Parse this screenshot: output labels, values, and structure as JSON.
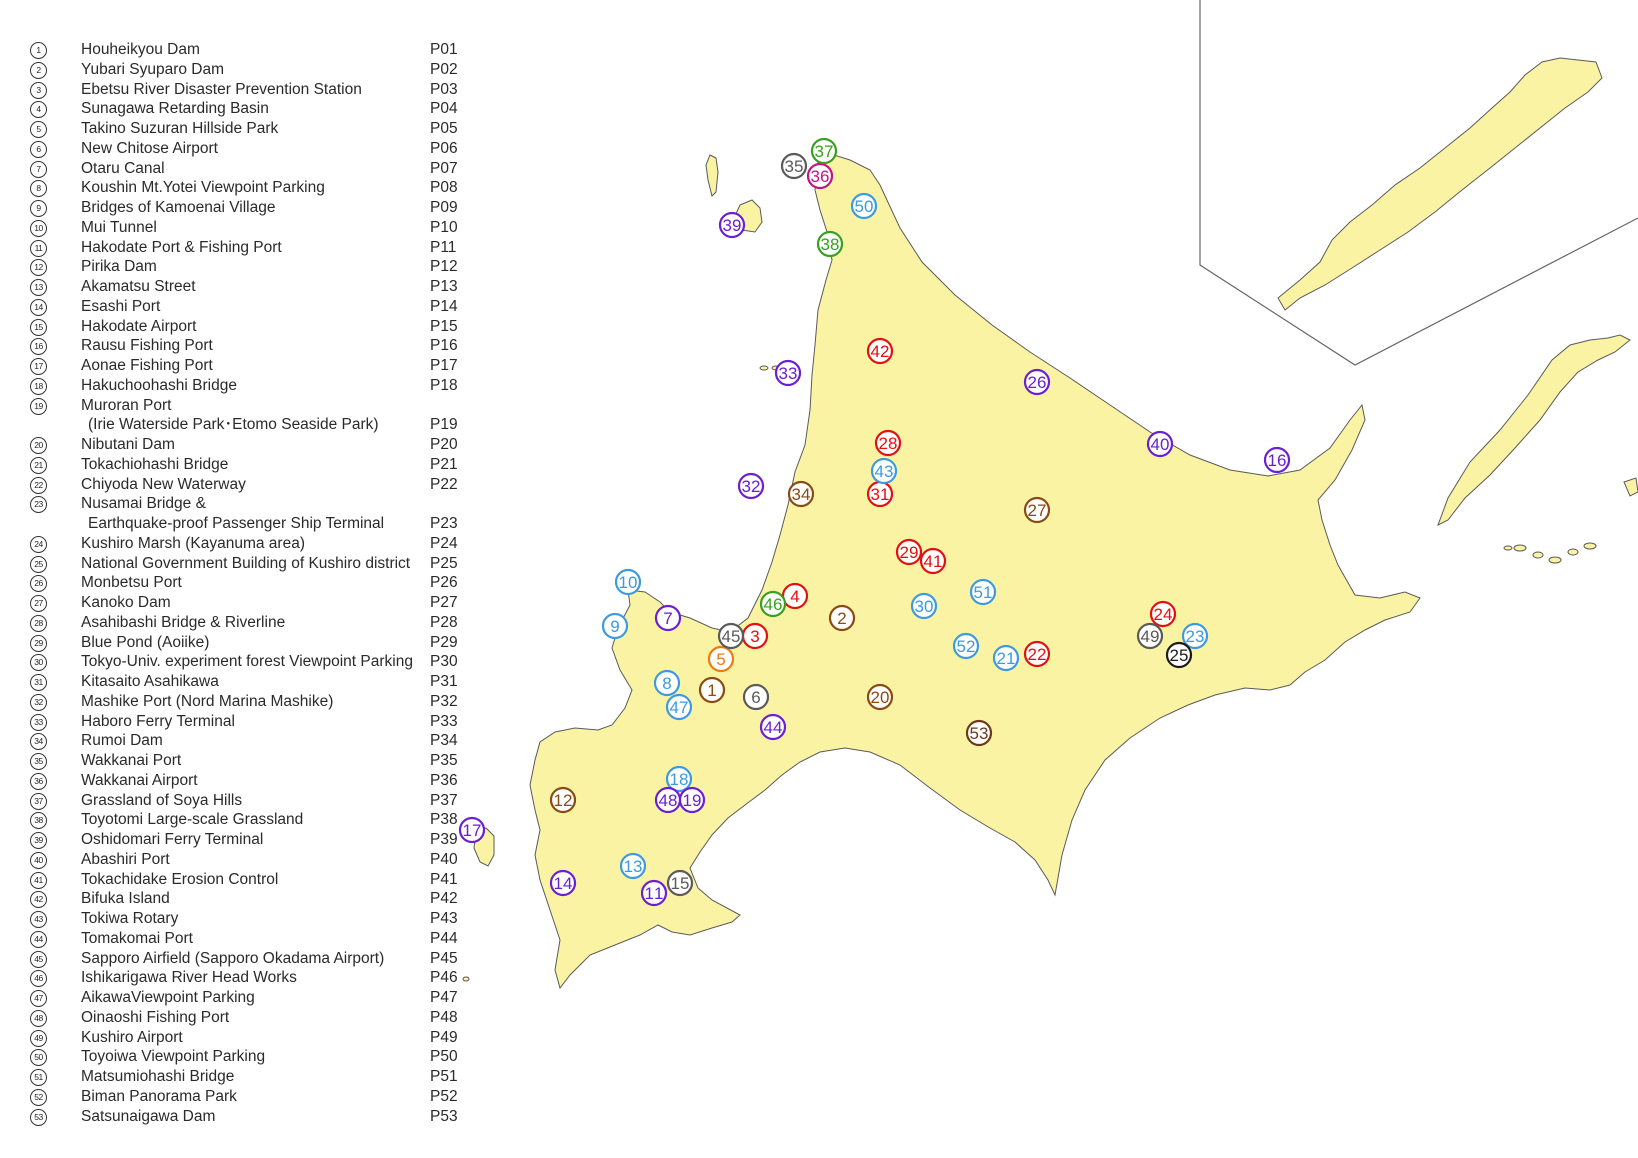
{
  "legend": [
    {
      "num": "1",
      "name": "Houheikyou Dam",
      "code": "P01"
    },
    {
      "num": "2",
      "name": "Yubari Syuparo Dam",
      "code": "P02"
    },
    {
      "num": "3",
      "name": "Ebetsu River Disaster Prevention Station",
      "code": "P03"
    },
    {
      "num": "4",
      "name": "Sunagawa Retarding Basin",
      "code": "P04"
    },
    {
      "num": "5",
      "name": "Takino Suzuran Hillside Park",
      "code": "P05"
    },
    {
      "num": "6",
      "name": "New Chitose Airport",
      "code": "P06"
    },
    {
      "num": "7",
      "name": "Otaru Canal",
      "code": "P07"
    },
    {
      "num": "8",
      "name": "Koushin Mt.Yotei Viewpoint Parking",
      "code": "P08"
    },
    {
      "num": "9",
      "name": "Bridges of Kamoenai Village",
      "code": "P09"
    },
    {
      "num": "10",
      "name": "Mui Tunnel",
      "code": "P10"
    },
    {
      "num": "11",
      "name": "Hakodate Port & Fishing Port",
      "code": "P11"
    },
    {
      "num": "12",
      "name": "Pirika Dam",
      "code": "P12"
    },
    {
      "num": "13",
      "name": "Akamatsu Street",
      "code": "P13"
    },
    {
      "num": "14",
      "name": "Esashi Port",
      "code": "P14"
    },
    {
      "num": "15",
      "name": "Hakodate Airport",
      "code": "P15"
    },
    {
      "num": "16",
      "name": "Rausu Fishing Port",
      "code": "P16"
    },
    {
      "num": "17",
      "name": "Aonae Fishing Port",
      "code": "P17"
    },
    {
      "num": "18",
      "name": "Hakuchoohashi Bridge",
      "code": "P18"
    },
    {
      "num": "19",
      "name": "Muroran Port",
      "code": ""
    },
    {
      "num": "",
      "name": "(Irie Waterside Park･Etomo Seaside Park)",
      "code": "P19"
    },
    {
      "num": "20",
      "name": "Nibutani Dam",
      "code": "P20"
    },
    {
      "num": "21",
      "name": "Tokachiohashi Bridge",
      "code": "P21"
    },
    {
      "num": "22",
      "name": "Chiyoda New Waterway",
      "code": "P22"
    },
    {
      "num": "23",
      "name": "Nusamai Bridge &",
      "code": ""
    },
    {
      "num": "",
      "name": "Earthquake-proof Passenger Ship Terminal",
      "code": "P23"
    },
    {
      "num": "24",
      "name": "Kushiro Marsh (Kayanuma area)",
      "code": "P24"
    },
    {
      "num": "25",
      "name": "National Government Building of Kushiro district",
      "code": "P25"
    },
    {
      "num": "26",
      "name": "Monbetsu Port",
      "code": "P26"
    },
    {
      "num": "27",
      "name": "Kanoko Dam",
      "code": "P27"
    },
    {
      "num": "28",
      "name": "Asahibashi Bridge & Riverline",
      "code": "P28"
    },
    {
      "num": "29",
      "name": "Blue Pond (Aoiike)",
      "code": "P29"
    },
    {
      "num": "30",
      "name": "Tokyo-Univ. experiment forest Viewpoint Parking",
      "code": "P30"
    },
    {
      "num": "31",
      "name": "Kitasaito Asahikawa",
      "code": "P31"
    },
    {
      "num": "32",
      "name": "Mashike Port (Nord Marina Mashike)",
      "code": "P32"
    },
    {
      "num": "33",
      "name": "Haboro Ferry Terminal",
      "code": "P33"
    },
    {
      "num": "34",
      "name": "Rumoi Dam",
      "code": "P34"
    },
    {
      "num": "35",
      "name": "Wakkanai Port",
      "code": "P35"
    },
    {
      "num": "36",
      "name": "Wakkanai Airport",
      "code": "P36"
    },
    {
      "num": "37",
      "name": "Grassland of Soya Hills",
      "code": "P37"
    },
    {
      "num": "38",
      "name": "Toyotomi Large-scale Grassland",
      "code": "P38"
    },
    {
      "num": "39",
      "name": "Oshidomari Ferry Terminal",
      "code": "P39"
    },
    {
      "num": "40",
      "name": "Abashiri Port",
      "code": "P40"
    },
    {
      "num": "41",
      "name": "Tokachidake Erosion Control",
      "code": "P41"
    },
    {
      "num": "42",
      "name": "Bifuka Island",
      "code": "P42"
    },
    {
      "num": "43",
      "name": "Tokiwa Rotary",
      "code": "P43"
    },
    {
      "num": "44",
      "name": "Tomakomai Port",
      "code": "P44"
    },
    {
      "num": "45",
      "name": "Sapporo Airfield (Sapporo Okadama Airport)",
      "code": "P45"
    },
    {
      "num": "46",
      "name": "Ishikarigawa River Head Works",
      "code": "P46"
    },
    {
      "num": "47",
      "name": "AikawaViewpoint Parking",
      "code": "P47"
    },
    {
      "num": "48",
      "name": "Oinaoshi Fishing Port",
      "code": "P48"
    },
    {
      "num": "49",
      "name": "Kushiro Airport",
      "code": "P49"
    },
    {
      "num": "50",
      "name": "Toyoiwa Viewpoint Parking",
      "code": "P50"
    },
    {
      "num": "51",
      "name": "Matsumiohashi Bridge",
      "code": "P51"
    },
    {
      "num": "52",
      "name": "Biman Panorama Park",
      "code": "P52"
    },
    {
      "num": "53",
      "name": "Satsunaigawa Dam",
      "code": "P53"
    }
  ],
  "colors": {
    "land": "#faf3a4",
    "coast": "#5a5a5a",
    "inset_frame": "#666666",
    "purple": "#6a1fd1",
    "blue": "#3d9ae0",
    "red": "#e31010",
    "brown": "#8a4a12",
    "green": "#38a01f",
    "black": "#1a1a1a",
    "gray": "#5a5a5a",
    "orange": "#f07a10",
    "magenta": "#c0158a",
    "dark_brown": "#6b3a1a"
  },
  "markers": [
    {
      "label": "1",
      "color": "brown"
    },
    {
      "label": "2",
      "color": "brown"
    },
    {
      "label": "3",
      "color": "red"
    },
    {
      "label": "4",
      "color": "red"
    },
    {
      "label": "5",
      "color": "orange"
    },
    {
      "label": "6",
      "color": "gray"
    },
    {
      "label": "7",
      "color": "purple"
    },
    {
      "label": "8",
      "color": "blue"
    },
    {
      "label": "9",
      "color": "blue"
    },
    {
      "label": "10",
      "color": "blue"
    },
    {
      "label": "11",
      "color": "purple"
    },
    {
      "label": "12",
      "color": "brown"
    },
    {
      "label": "13",
      "color": "blue"
    },
    {
      "label": "14",
      "color": "purple"
    },
    {
      "label": "15",
      "color": "gray"
    },
    {
      "label": "16",
      "color": "purple"
    },
    {
      "label": "17",
      "color": "purple"
    },
    {
      "label": "18",
      "color": "blue"
    },
    {
      "label": "19",
      "color": "purple"
    },
    {
      "label": "20",
      "color": "brown"
    },
    {
      "label": "21",
      "color": "blue"
    },
    {
      "label": "22",
      "color": "red"
    },
    {
      "label": "23",
      "color": "blue"
    },
    {
      "label": "24",
      "color": "red"
    },
    {
      "label": "25",
      "color": "black"
    },
    {
      "label": "26",
      "color": "purple"
    },
    {
      "label": "27",
      "color": "brown"
    },
    {
      "label": "28",
      "color": "red"
    },
    {
      "label": "29",
      "color": "red"
    },
    {
      "label": "30",
      "color": "blue"
    },
    {
      "label": "31",
      "color": "red"
    },
    {
      "label": "32",
      "color": "purple"
    },
    {
      "label": "33",
      "color": "purple"
    },
    {
      "label": "34",
      "color": "brown"
    },
    {
      "label": "35",
      "color": "gray"
    },
    {
      "label": "36",
      "color": "magenta"
    },
    {
      "label": "37",
      "color": "green"
    },
    {
      "label": "38",
      "color": "green"
    },
    {
      "label": "39",
      "color": "purple"
    },
    {
      "label": "40",
      "color": "purple"
    },
    {
      "label": "41",
      "color": "red"
    },
    {
      "label": "42",
      "color": "red"
    },
    {
      "label": "43",
      "color": "blue"
    },
    {
      "label": "44",
      "color": "purple"
    },
    {
      "label": "45",
      "color": "gray"
    },
    {
      "label": "46",
      "color": "green"
    },
    {
      "label": "47",
      "color": "blue"
    },
    {
      "label": "48",
      "color": "purple"
    },
    {
      "label": "49",
      "color": "gray"
    },
    {
      "label": "50",
      "color": "blue"
    },
    {
      "label": "51",
      "color": "blue"
    },
    {
      "label": "52",
      "color": "blue"
    },
    {
      "label": "53",
      "color": "dark_brown"
    }
  ]
}
